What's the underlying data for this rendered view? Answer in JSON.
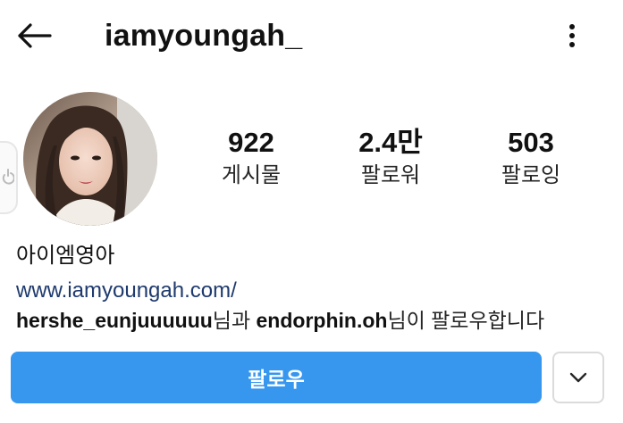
{
  "header": {
    "username": "iamyoungah_",
    "back_icon": "arrow-left-icon",
    "more_icon": "vertical-ellipsis-icon"
  },
  "profile": {
    "avatar_alt": "profile photo",
    "stats": {
      "posts": {
        "value": "922",
        "label": "게시물"
      },
      "followers": {
        "value": "2.4만",
        "label": "팔로워"
      },
      "following": {
        "value": "503",
        "label": "팔로잉"
      }
    },
    "display_name": "아이엠영아",
    "website": "www.iamyoungah.com/",
    "followed_by": {
      "user1": "hershe_eunjuuuuuu",
      "connector1": "님과 ",
      "user2": "endorphin.oh",
      "suffix": "님이 팔로우합니다"
    }
  },
  "actions": {
    "follow_label": "팔로우",
    "dropdown_icon": "chevron-down-icon"
  },
  "colors": {
    "follow_button": "#3797ef",
    "link": "#1e3a6e",
    "text": "#262626"
  }
}
